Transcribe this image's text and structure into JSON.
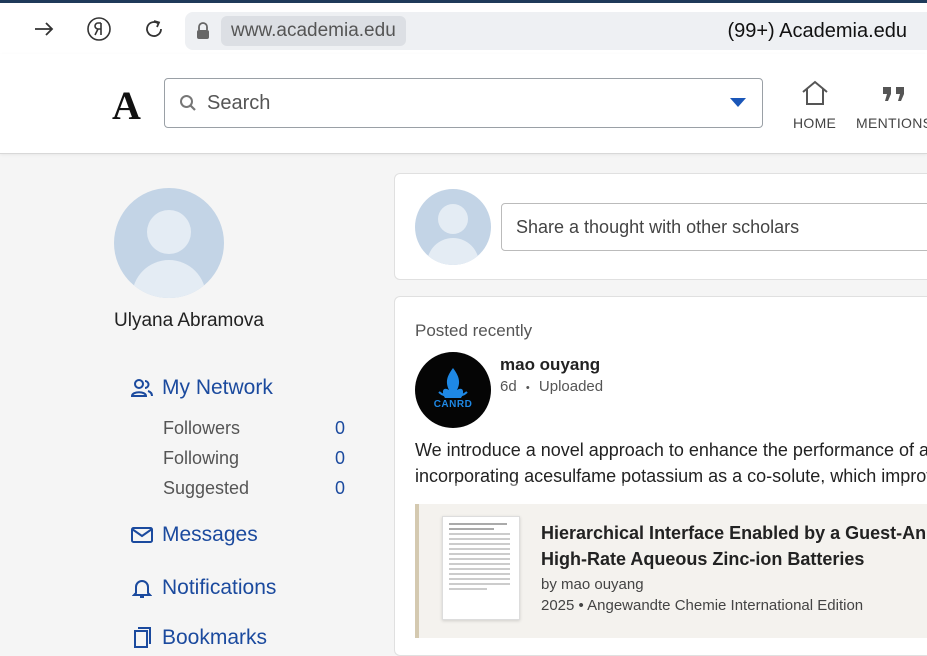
{
  "browser": {
    "url": "www.academia.edu",
    "tab_title": "(99+) Academia.edu"
  },
  "header": {
    "logo": "A",
    "search_placeholder": "Search",
    "nav": [
      {
        "label": "HOME"
      },
      {
        "label": "MENTIONS"
      }
    ]
  },
  "sidebar": {
    "user_name": "Ulyana Abramova",
    "my_network": "My Network",
    "stats": [
      {
        "label": "Followers",
        "value": "0"
      },
      {
        "label": "Following",
        "value": "0"
      },
      {
        "label": "Suggested",
        "value": "0"
      }
    ],
    "messages": "Messages",
    "notifications": "Notifications",
    "bookmarks": "Bookmarks"
  },
  "compose": {
    "placeholder": "Share a thought with other scholars"
  },
  "post": {
    "section_label": "Posted recently",
    "author": "mao ouyang",
    "logo_text": "CANRD",
    "age": "6d",
    "action": "Uploaded",
    "meta_sep": "•",
    "text_lines": [
      "We introduce a novel approach to enhance the performance of aqu",
      "incorporating acesulfame potassium as a co-solute, which improve"
    ],
    "paper": {
      "title_line1": "Hierarchical Interface Enabled by a Guest-Anionic",
      "title_line2": "High-Rate Aqueous Zinc-ion Batteries",
      "by": "by mao ouyang",
      "year_venue": "2025 • Angewandte Chemie International Edition"
    }
  }
}
